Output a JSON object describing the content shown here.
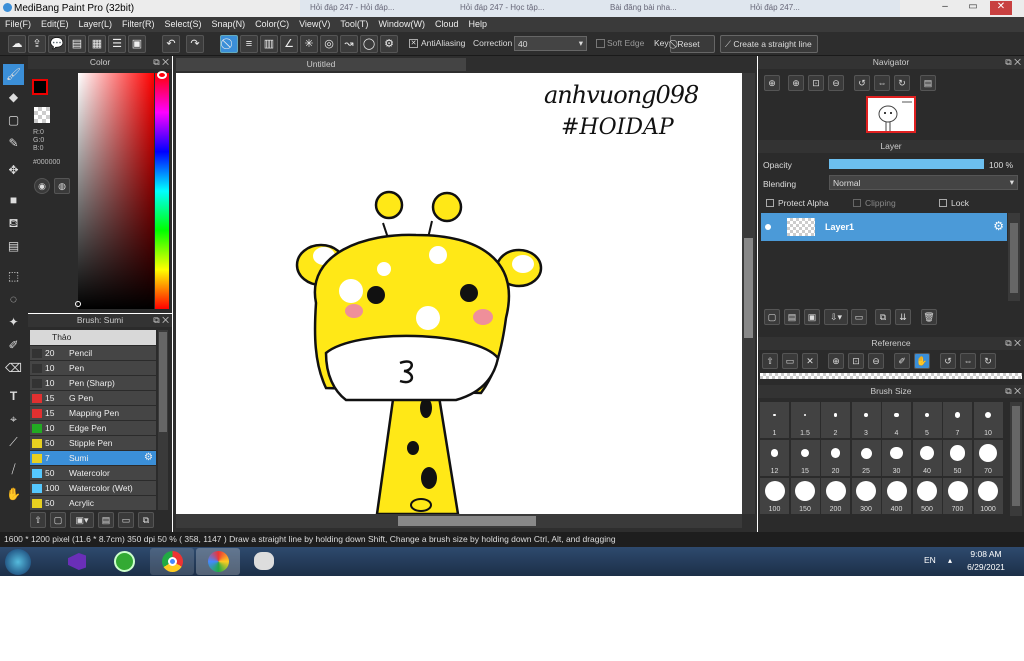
{
  "window": {
    "title": "MediBang Paint Pro (32bit)",
    "buttons": [
      "–",
      "▭",
      "✕"
    ]
  },
  "browser_tabs": [
    "Hỏi đáp 247 - Hỏi đáp...",
    "Hỏi đáp 247 - Học tập...",
    "Bài đăng bài nha...",
    "Hỏi đáp 247..."
  ],
  "menu": [
    "File(F)",
    "Edit(E)",
    "Layer(L)",
    "Filter(R)",
    "Select(S)",
    "Snap(N)",
    "Color(C)",
    "View(V)",
    "Tool(T)",
    "Window(W)",
    "Cloud",
    "Help"
  ],
  "toolbar": {
    "antialiasing_label": "AntiAliasing",
    "correction_label": "Correction",
    "correction_value": "40",
    "soft_edge_label": "Soft Edge",
    "key_label": "Key",
    "reset_label": "Reset",
    "straight_line_label": "Create a straight line"
  },
  "color_panel": {
    "title": "Color",
    "r": "R:0",
    "g": "G:0",
    "b": "B:0",
    "hex": "#000000",
    "foreground": "#000000",
    "accent": "#ff0000"
  },
  "brush_panel": {
    "title": "Brush: Sumi",
    "group": "Thảo",
    "items": [
      {
        "size": "20",
        "name": "Pencil",
        "color": "#333333"
      },
      {
        "size": "10",
        "name": "Pen",
        "color": "#333333"
      },
      {
        "size": "10",
        "name": "Pen (Sharp)",
        "color": "#333333"
      },
      {
        "size": "15",
        "name": "G Pen",
        "color": "#e03030"
      },
      {
        "size": "15",
        "name": "Mapping Pen",
        "color": "#e03030"
      },
      {
        "size": "10",
        "name": "Edge Pen",
        "color": "#22aa22"
      },
      {
        "size": "50",
        "name": "Stipple Pen",
        "color": "#e8d020"
      },
      {
        "size": "7",
        "name": "Sumi",
        "color": "#e8d020"
      },
      {
        "size": "50",
        "name": "Watercolor",
        "color": "#55c8ff"
      },
      {
        "size": "100",
        "name": "Watercolor (Wet)",
        "color": "#55c8ff"
      },
      {
        "size": "50",
        "name": "Acrylic",
        "color": "#e8d020"
      }
    ]
  },
  "document": {
    "tab": "Untitled",
    "signature_line1": "anhvuong098",
    "signature_line2": "#HOIDAP"
  },
  "navigator": {
    "title": "Navigator"
  },
  "layer_panel": {
    "title": "Layer",
    "opacity_label": "Opacity",
    "opacity_value": "100 %",
    "opacity_fraction": 1.0,
    "blending_label": "Blending",
    "blending_value": "Normal",
    "protect_alpha": "Protect Alpha",
    "clipping": "Clipping",
    "lock": "Lock",
    "layers": [
      {
        "name": "Layer1"
      }
    ]
  },
  "reference": {
    "title": "Reference"
  },
  "brush_size": {
    "title": "Brush Size",
    "sizes": [
      "1",
      "1.5",
      "2",
      "3",
      "4",
      "5",
      "7",
      "10",
      "12",
      "15",
      "20",
      "25",
      "30",
      "40",
      "50",
      "70",
      "100",
      "150",
      "200",
      "300",
      "400",
      "500",
      "700",
      "1000"
    ]
  },
  "status": "1600 * 1200 pixel   (11.6 * 8.7cm)  350 dpi  50 %   ( 358, 1147 )   Draw a straight line by holding down Shift, Change a brush size by holding down Ctrl, Alt, and dragging",
  "taskbar": {
    "lang": "EN",
    "time": "9:08 AM",
    "date": "6/29/2021"
  }
}
